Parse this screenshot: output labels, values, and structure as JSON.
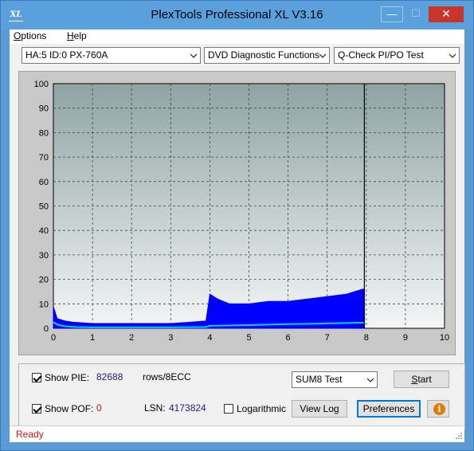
{
  "window": {
    "title": "PlexTools Professional XL V3.16",
    "icon": "xl-app-icon",
    "icon_text": "XL",
    "minimize_glyph": "—",
    "maximize_glyph": "☐",
    "close_glyph": "✕"
  },
  "menu": {
    "options_first": "O",
    "options_rest": "ptions",
    "help_first": "H",
    "help_rest": "elp"
  },
  "toolbar": {
    "drive": "HA:5 ID:0  PX-760A",
    "function": "DVD Diagnostic Functions",
    "test": "Q-Check PI/PO Test"
  },
  "chart_data": {
    "type": "area",
    "xlim": [
      0,
      10
    ],
    "ylim": [
      0,
      100
    ],
    "xticks": [
      0,
      1,
      2,
      3,
      4,
      5,
      6,
      7,
      8,
      9,
      10
    ],
    "yticks": [
      0,
      10,
      20,
      30,
      40,
      50,
      60,
      70,
      80,
      90,
      100
    ],
    "grid": true,
    "series": [
      {
        "color": "#0000ff",
        "x": [
          0,
          0.1,
          0.3,
          0.5,
          1.0,
          1.5,
          2.0,
          2.5,
          3.0,
          3.5,
          3.9,
          4.0,
          4.2,
          4.5,
          5.0,
          5.5,
          6.0,
          6.5,
          7.0,
          7.5,
          7.9,
          7.95
        ],
        "y": [
          9,
          4,
          3,
          2.5,
          2,
          2,
          2,
          2,
          2,
          2.5,
          3,
          14,
          12,
          10,
          10,
          11,
          11,
          12,
          13,
          14,
          16,
          16
        ]
      },
      {
        "color": "#00d8d8",
        "x": [
          0,
          0.1,
          0.3,
          0.6,
          1.0,
          2.0,
          3.0,
          3.9,
          4.0,
          5.0,
          6.0,
          7.0,
          7.95
        ],
        "y": [
          2.5,
          1.5,
          0.8,
          0.5,
          0.4,
          0.4,
          0.4,
          0.5,
          1.0,
          1.3,
          1.7,
          2.0,
          2.3
        ]
      }
    ],
    "cursor_x": 7.95,
    "bg_top": "#8fa3a3",
    "bg_bottom": "#f4f6f6"
  },
  "controls": {
    "show_pie_label": "Show PIE:",
    "pie_value": "82688",
    "pie_unit": "rows/8ECC",
    "show_pof_label": "Show POF:",
    "pof_value": "0",
    "lsn_label": "LSN:",
    "lsn_value": "4173824",
    "log_label": "Logarithmic",
    "sum_select": "SUM8 Test",
    "start_first": "S",
    "start_rest": "tart",
    "view_log": "View Log",
    "preferences": "Preferences",
    "info_glyph": "i"
  },
  "status": {
    "text": "Ready"
  }
}
